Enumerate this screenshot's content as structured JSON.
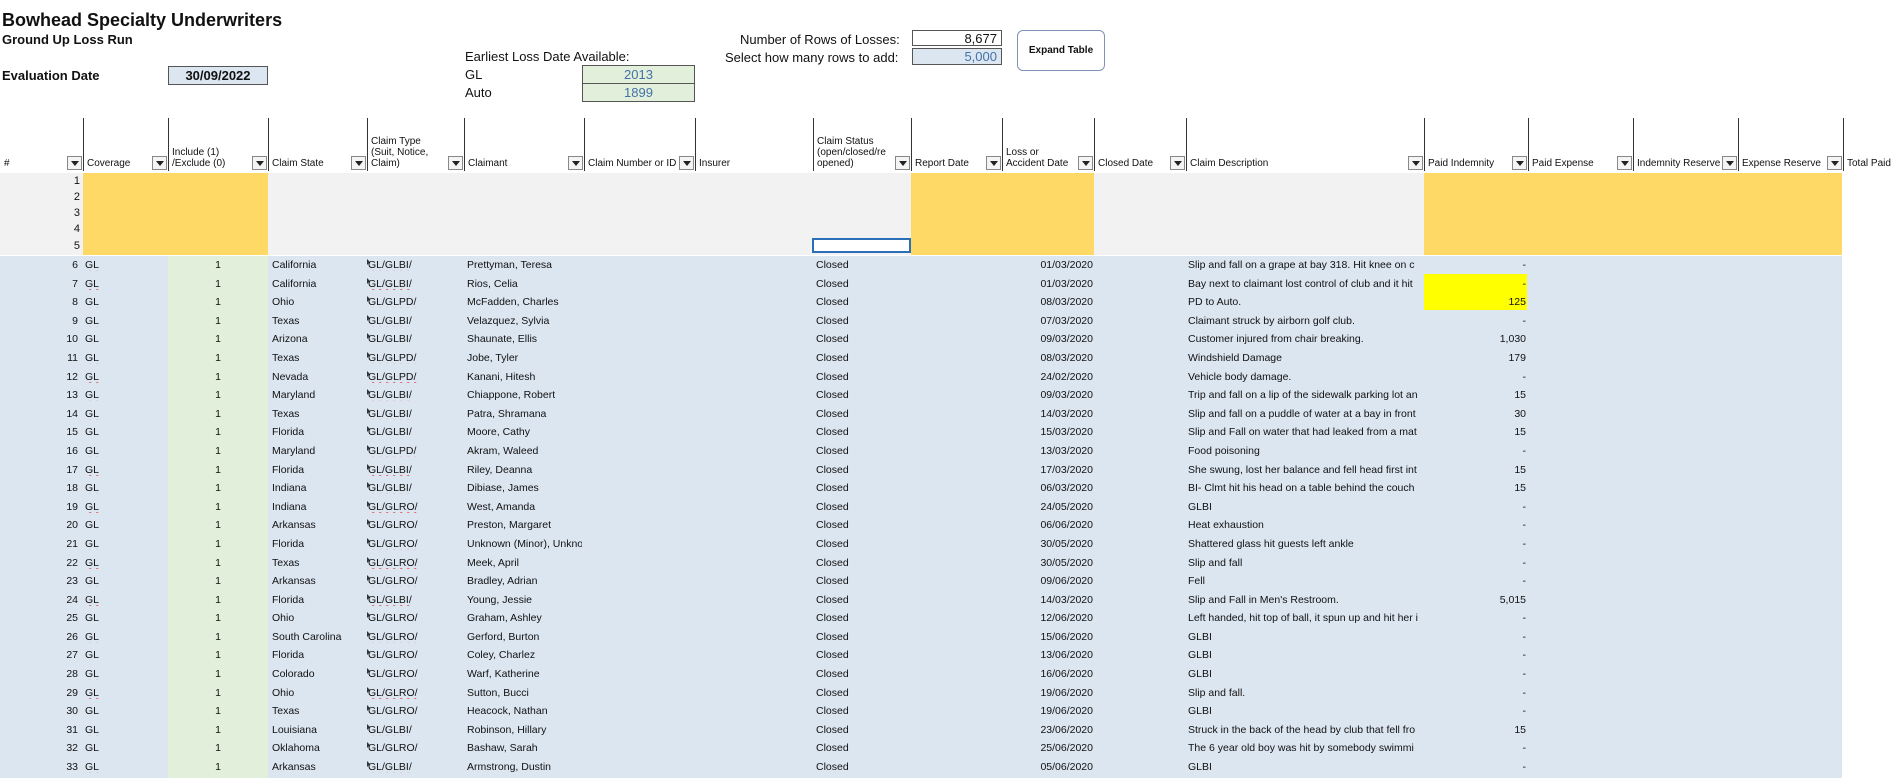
{
  "header": {
    "company": "Bowhead Specialty Underwriters",
    "subtitle": "Ground Up Loss Run",
    "evaluation_label": "Evaluation Date",
    "evaluation_date": "30/09/2022",
    "earliest_label": "Earliest Loss Date Available:",
    "gl_label": "GL",
    "gl_year": "2013",
    "auto_label": "Auto",
    "auto_year": "1899",
    "rows_label": "Number of Rows of Losses:",
    "rows_value": "8,677",
    "add_rows_label": "Select how many rows to add:",
    "add_rows_value": "5,000",
    "expand_button": "Expand Table"
  },
  "columns": {
    "num": "#",
    "coverage": "Coverage",
    "include": "Include (1) /Exclude (0)",
    "claim_state": "Claim State",
    "claim_type": "Claim Type (Suit, Notice, Claim)",
    "claimant": "Claimant",
    "claim_number": "Claim Number or ID",
    "insurer": "Insurer",
    "claim_status": "Claim Status (open/closed/re opened)",
    "report_date": "Report Date",
    "loss_date": "Loss or Accident Date",
    "closed_date": "Closed Date",
    "claim_description": "Claim Description",
    "paid_indemnity": "Paid Indemnity",
    "paid_expense": "Paid Expense",
    "indemnity_reserve": "Indemnity Reserve",
    "expense_reserve": "Expense Reserve",
    "total_paid": "Total Paid"
  },
  "input_rows": [
    "1",
    "2",
    "3",
    "4",
    "5"
  ],
  "rows": [
    {
      "n": "6",
      "cov": "GL",
      "inc": "1",
      "state": "California",
      "type": "GL/GLBI/",
      "claimant": "Prettyman, Teresa",
      "status": "Closed",
      "loss": "01/03/2020",
      "desc": "Slip and fall on a grape at bay 318.  Hit knee on c",
      "paid": "-"
    },
    {
      "n": "7",
      "cov": "GL",
      "inc": "1",
      "state": "California",
      "type": "GL/GLBI/",
      "claimant": "Rios, Celia",
      "status": "Closed",
      "loss": "01/03/2020",
      "desc": "Bay next to claimant lost control of club and it hit",
      "paid": "-"
    },
    {
      "n": "8",
      "cov": "GL",
      "inc": "1",
      "state": "Ohio",
      "type": "GL/GLPD/",
      "claimant": "McFadden, Charles",
      "status": "Closed",
      "loss": "08/03/2020",
      "desc": "PD to Auto.",
      "paid": "125"
    },
    {
      "n": "9",
      "cov": "GL",
      "inc": "1",
      "state": "Texas",
      "type": "GL/GLBI/",
      "claimant": "Velazquez, Sylvia",
      "status": "Closed",
      "loss": "07/03/2020",
      "desc": "Claimant struck by airborn golf club.",
      "paid": "-"
    },
    {
      "n": "10",
      "cov": "GL",
      "inc": "1",
      "state": "Arizona",
      "type": "GL/GLBI/",
      "claimant": "Shaunate, Ellis",
      "status": "Closed",
      "loss": "09/03/2020",
      "desc": "Customer injured from chair breaking.",
      "paid": "1,030"
    },
    {
      "n": "11",
      "cov": "GL",
      "inc": "1",
      "state": "Texas",
      "type": "GL/GLPD/",
      "claimant": "Jobe, Tyler",
      "status": "Closed",
      "loss": "08/03/2020",
      "desc": "Windshield Damage",
      "paid": "179"
    },
    {
      "n": "12",
      "cov": "GL",
      "inc": "1",
      "state": "Nevada",
      "type": "GL/GLPD/",
      "claimant": "Kanani, Hitesh",
      "status": "Closed",
      "loss": "24/02/2020",
      "desc": "Vehicle body damage.",
      "paid": "-"
    },
    {
      "n": "13",
      "cov": "GL",
      "inc": "1",
      "state": "Maryland",
      "type": "GL/GLBI/",
      "claimant": "Chiappone, Robert",
      "status": "Closed",
      "loss": "09/03/2020",
      "desc": "Trip and fall on a lip of the sidewalk parking lot an",
      "paid": "15"
    },
    {
      "n": "14",
      "cov": "GL",
      "inc": "1",
      "state": "Texas",
      "type": "GL/GLBI/",
      "claimant": "Patra, Shramana",
      "status": "Closed",
      "loss": "14/03/2020",
      "desc": "Slip and fall on a puddle of water at a bay in front",
      "paid": "30"
    },
    {
      "n": "15",
      "cov": "GL",
      "inc": "1",
      "state": "Florida",
      "type": "GL/GLBI/",
      "claimant": "Moore, Cathy",
      "status": "Closed",
      "loss": "15/03/2020",
      "desc": "Slip and Fall on water that had leaked from a mat",
      "paid": "15"
    },
    {
      "n": "16",
      "cov": "GL",
      "inc": "1",
      "state": "Maryland",
      "type": "GL/GLPD/",
      "claimant": "Akram, Waleed",
      "status": "Closed",
      "loss": "13/03/2020",
      "desc": "Food poisoning",
      "paid": "-"
    },
    {
      "n": "17",
      "cov": "GL",
      "inc": "1",
      "state": "Florida",
      "type": "GL/GLBI/",
      "claimant": "Riley, Deanna",
      "status": "Closed",
      "loss": "17/03/2020",
      "desc": "She swung, lost her balance and fell head first int",
      "paid": "15"
    },
    {
      "n": "18",
      "cov": "GL",
      "inc": "1",
      "state": "Indiana",
      "type": "GL/GLBI/",
      "claimant": "Dibiase, James",
      "status": "Closed",
      "loss": "06/03/2020",
      "desc": "BI- Clmt hit his head on a table behind the couch",
      "paid": "15"
    },
    {
      "n": "19",
      "cov": "GL",
      "inc": "1",
      "state": "Indiana",
      "type": "GL/GLRO/",
      "claimant": "West, Amanda",
      "status": "Closed",
      "loss": "24/05/2020",
      "desc": "GLBI",
      "paid": "-"
    },
    {
      "n": "20",
      "cov": "GL",
      "inc": "1",
      "state": "Arkansas",
      "type": "GL/GLRO/",
      "claimant": "Preston, Margaret",
      "status": "Closed",
      "loss": "06/06/2020",
      "desc": "Heat exhaustion",
      "paid": "-"
    },
    {
      "n": "21",
      "cov": "GL",
      "inc": "1",
      "state": "Florida",
      "type": "GL/GLRO/",
      "claimant": "Unknown (Minor), Unknown",
      "status": "Closed",
      "loss": "30/05/2020",
      "desc": "Shattered glass hit guests left ankle",
      "paid": "-"
    },
    {
      "n": "22",
      "cov": "GL",
      "inc": "1",
      "state": "Texas",
      "type": "GL/GLRO/",
      "claimant": "Meek, April",
      "status": "Closed",
      "loss": "30/05/2020",
      "desc": "Slip and fall",
      "paid": "-"
    },
    {
      "n": "23",
      "cov": "GL",
      "inc": "1",
      "state": "Arkansas",
      "type": "GL/GLRO/",
      "claimant": "Bradley, Adrian",
      "status": "Closed",
      "loss": "09/06/2020",
      "desc": "Fell",
      "paid": "-"
    },
    {
      "n": "24",
      "cov": "GL",
      "inc": "1",
      "state": "Florida",
      "type": "GL/GLBI/",
      "claimant": "Young, Jessie",
      "status": "Closed",
      "loss": "14/03/2020",
      "desc": "Slip and Fall in Men's Restroom.",
      "paid": "5,015"
    },
    {
      "n": "25",
      "cov": "GL",
      "inc": "1",
      "state": "Ohio",
      "type": "GL/GLRO/",
      "claimant": "Graham, Ashley",
      "status": "Closed",
      "loss": "12/06/2020",
      "desc": "Left handed, hit top of ball, it spun up and hit her i",
      "paid": "-"
    },
    {
      "n": "26",
      "cov": "GL",
      "inc": "1",
      "state": "South Carolina",
      "type": "GL/GLRO/",
      "claimant": "Gerford, Burton",
      "status": "Closed",
      "loss": "15/06/2020",
      "desc": "GLBI",
      "paid": "-"
    },
    {
      "n": "27",
      "cov": "GL",
      "inc": "1",
      "state": "Florida",
      "type": "GL/GLRO/",
      "claimant": "Coley, Charlez",
      "status": "Closed",
      "loss": "13/06/2020",
      "desc": "GLBI",
      "paid": "-"
    },
    {
      "n": "28",
      "cov": "GL",
      "inc": "1",
      "state": "Colorado",
      "type": "GL/GLRO/",
      "claimant": "Warf, Katherine",
      "status": "Closed",
      "loss": "16/06/2020",
      "desc": "GLBI",
      "paid": "-"
    },
    {
      "n": "29",
      "cov": "GL",
      "inc": "1",
      "state": "Ohio",
      "type": "GL/GLRO/",
      "claimant": "Sutton, Bucci",
      "status": "Closed",
      "loss": "19/06/2020",
      "desc": "Slip and fall.",
      "paid": "-"
    },
    {
      "n": "30",
      "cov": "GL",
      "inc": "1",
      "state": "Texas",
      "type": "GL/GLRO/",
      "claimant": "Heacock, Nathan",
      "status": "Closed",
      "loss": "19/06/2020",
      "desc": "GLBI",
      "paid": "-"
    },
    {
      "n": "31",
      "cov": "GL",
      "inc": "1",
      "state": "Louisiana",
      "type": "GL/GLBI/",
      "claimant": "Robinson, Hillary",
      "status": "Closed",
      "loss": "23/06/2020",
      "desc": "Struck in the back of the head by club that fell fro",
      "paid": "15"
    },
    {
      "n": "32",
      "cov": "GL",
      "inc": "1",
      "state": "Oklahoma",
      "type": "GL/GLRO/",
      "claimant": "Bashaw, Sarah",
      "status": "Closed",
      "loss": "25/06/2020",
      "desc": "The 6 year old boy was hit by somebody swimmi",
      "paid": "-"
    },
    {
      "n": "33",
      "cov": "GL",
      "inc": "1",
      "state": "Arkansas",
      "type": "GL/GLBI/",
      "claimant": "Armstrong, Dustin",
      "status": "Closed",
      "loss": "05/06/2020",
      "desc": "GLBI",
      "paid": "-"
    }
  ],
  "colors": {
    "input_yellow": "#ffd966",
    "data_blue": "#dce6f1",
    "include_green": "#e2efda",
    "highlight": "#ffff00",
    "selection": "#2a6fb8"
  }
}
